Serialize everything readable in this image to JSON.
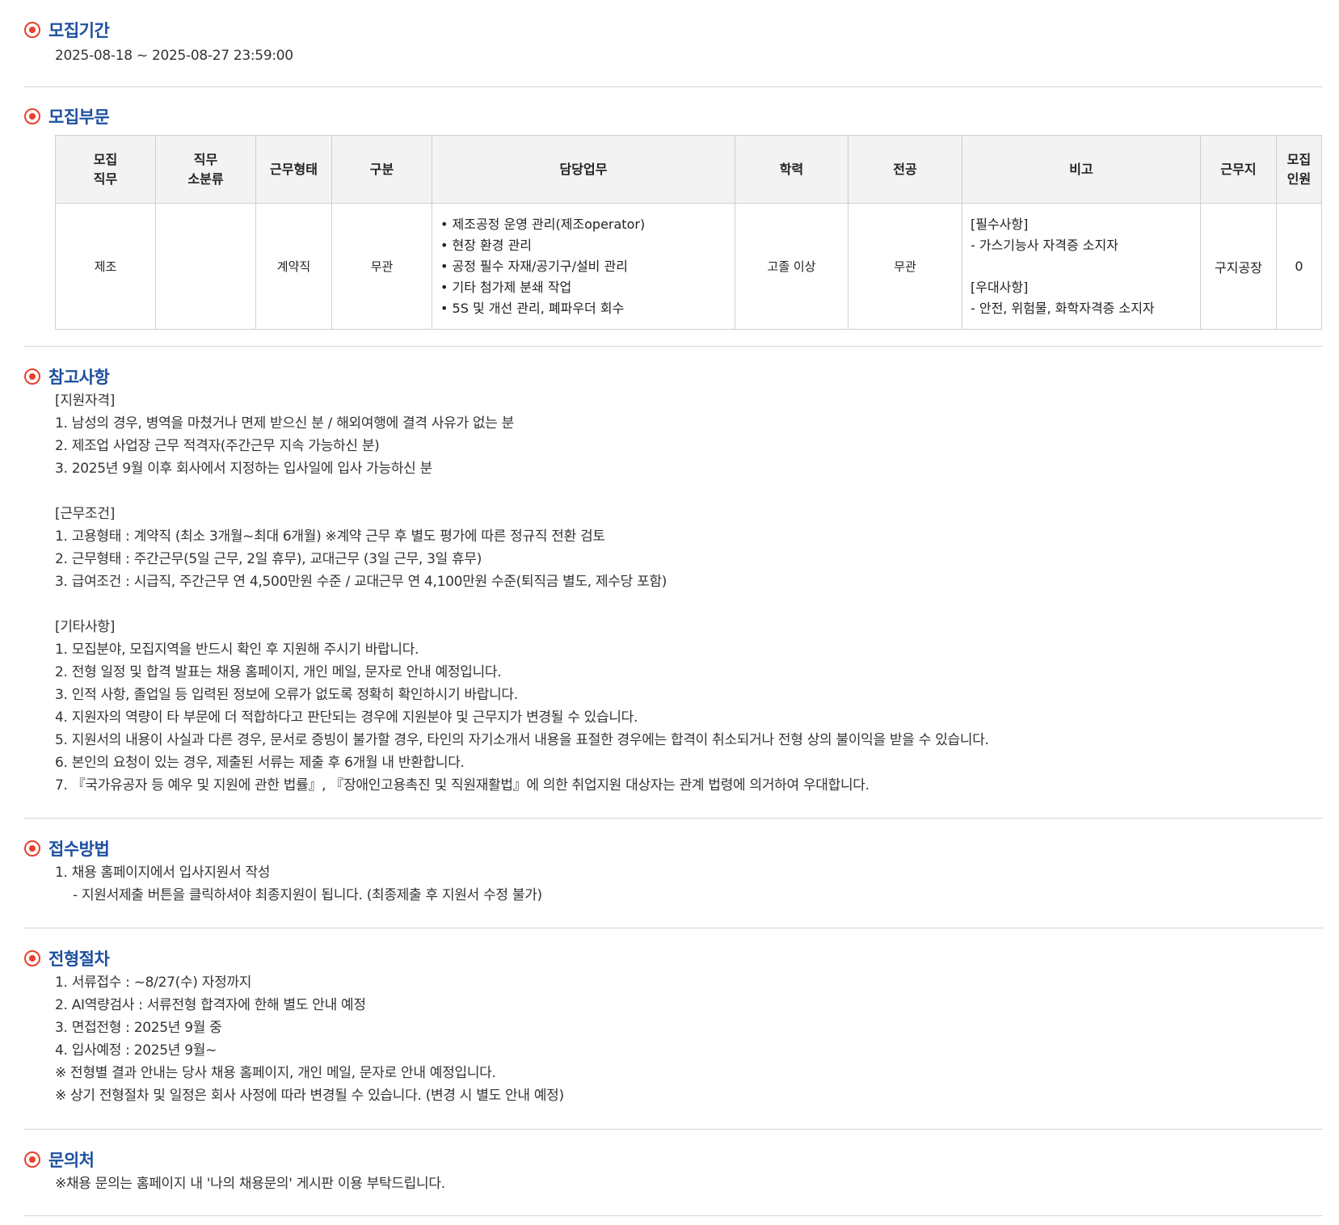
{
  "period": {
    "title": "모집기간",
    "text": "2025-08-18 ~ 2025-08-27 23:59:00"
  },
  "division": {
    "title": "모집부문",
    "headers": [
      "모집\n직무",
      "직무\n소분류",
      "근무형태",
      "구분",
      "담당업무",
      "학력",
      "전공",
      "비고",
      "근무지",
      "모집\n인원"
    ],
    "row": {
      "job": "제조",
      "subcategory": "",
      "employment": "계약직",
      "type": "무관",
      "duties": [
        "• 제조공정 운영 관리(제조operator)",
        "• 현장 환경 관리",
        "• 공정 필수 자재/공기구/설비 관리",
        "• 기타 첨가제 분쇄 작업",
        "• 5S 및 개선 관리, 폐파우더 회수"
      ],
      "education": "고졸 이상",
      "major": "무관",
      "notes": [
        "[필수사항]",
        "- 가스기능사 자격증 소지자",
        "",
        "[우대사항]",
        "- 안전, 위험물, 화학자격증 소지자"
      ],
      "location": "구지공장",
      "headcount": "0"
    }
  },
  "reference": {
    "title": "참고사항",
    "lines": [
      "[지원자격]",
      "1. 남성의 경우, 병역을 마쳤거나 면제 받으신 분 / 해외여행에 결격 사유가 없는 분",
      "2. 제조업 사업장 근무 적격자(주간근무 지속 가능하신 분)",
      "3. 2025년 9월 이후 회사에서 지정하는 입사일에 입사 가능하신 분",
      "",
      "[근무조건]",
      "1. 고용형태 : 계약직 (최소 3개월~최대 6개월) ※계약 근무 후 별도 평가에 따른 정규직 전환 검토",
      "2. 근무형태 : 주간근무(5일 근무, 2일 휴무), 교대근무 (3일 근무, 3일 휴무)",
      "3. 급여조건 : 시급직, 주간근무 연 4,500만원 수준 / 교대근무 연 4,100만원 수준(퇴직금 별도, 제수당 포함)",
      "",
      "[기타사항]",
      "1. 모집분야, 모집지역을 반드시 확인 후 지원해 주시기 바랍니다.",
      "2. 전형 일정 및 합격 발표는 채용 홈페이지, 개인 메일, 문자로 안내 예정입니다.",
      "3. 인적 사항, 졸업일 등 입력된 정보에 오류가 없도록 정확히 확인하시기 바랍니다.",
      "4. 지원자의 역량이 타 부문에 더 적합하다고 판단되는 경우에 지원분야 및 근무지가 변경될 수 있습니다.",
      "5. 지원서의 내용이 사실과 다른 경우, 문서로 증빙이 불가할 경우, 타인의 자기소개서 내용을 표절한 경우에는 합격이 취소되거나 전형 상의 불이익을 받을 수 있습니다.",
      "6. 본인의 요청이 있는 경우, 제출된 서류는 제출 후 6개월 내 반환합니다.",
      "7. 『국가유공자 등 예우 및 지원에 관한 법률』, 『장애인고용촉진 및 직원재활법』에 의한 취업지원 대상자는 관계 법령에 의거하여 우대합니다."
    ]
  },
  "apply": {
    "title": "접수방법",
    "line1": "1. 채용 홈페이지에서 입사지원서 작성",
    "line2": "- 지원서제출 버튼을 클릭하셔야 최종지원이 됩니다. (최종제출 후 지원서 수정 불가)"
  },
  "process": {
    "title": "전형절차",
    "lines": [
      "1. 서류접수 : ~8/27(수) 자정까지",
      "2. AI역량검사 : 서류전형 합격자에 한해 별도 안내 예정",
      "3. 면접전형 : 2025년 9월 중",
      "4. 입사예정 : 2025년 9월~",
      "※ 전형별 결과 안내는 당사 채용 홈페이지, 개인 메일, 문자로 안내 예정입니다.",
      "※ 상기 전형절차 및 일정은 회사 사정에 따라 변경될 수 있습니다. (변경 시 별도 안내 예정)"
    ]
  },
  "contact": {
    "title": "문의처",
    "text": "※채용 문의는 홈페이지 내 '나의 채용문의' 게시판 이용 부탁드립니다."
  }
}
